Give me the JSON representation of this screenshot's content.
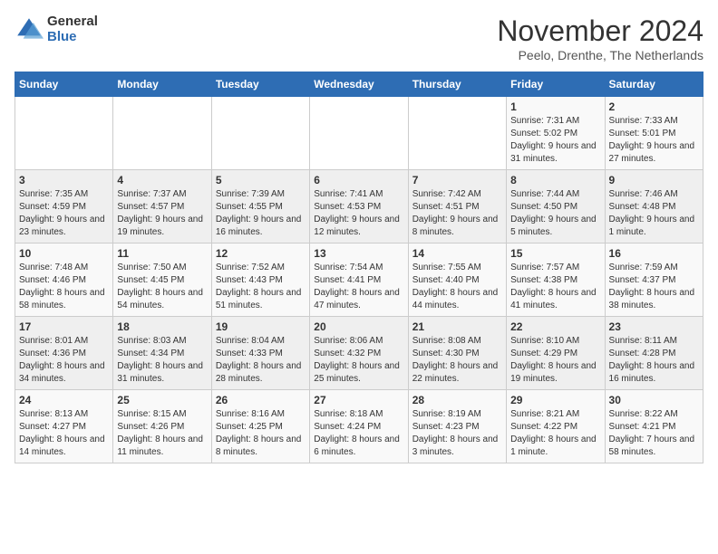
{
  "logo": {
    "general": "General",
    "blue": "Blue"
  },
  "header": {
    "month": "November 2024",
    "location": "Peelo, Drenthe, The Netherlands"
  },
  "weekdays": [
    "Sunday",
    "Monday",
    "Tuesday",
    "Wednesday",
    "Thursday",
    "Friday",
    "Saturday"
  ],
  "weeks": [
    [
      {
        "day": "",
        "info": ""
      },
      {
        "day": "",
        "info": ""
      },
      {
        "day": "",
        "info": ""
      },
      {
        "day": "",
        "info": ""
      },
      {
        "day": "",
        "info": ""
      },
      {
        "day": "1",
        "info": "Sunrise: 7:31 AM\nSunset: 5:02 PM\nDaylight: 9 hours and 31 minutes."
      },
      {
        "day": "2",
        "info": "Sunrise: 7:33 AM\nSunset: 5:01 PM\nDaylight: 9 hours and 27 minutes."
      }
    ],
    [
      {
        "day": "3",
        "info": "Sunrise: 7:35 AM\nSunset: 4:59 PM\nDaylight: 9 hours and 23 minutes."
      },
      {
        "day": "4",
        "info": "Sunrise: 7:37 AM\nSunset: 4:57 PM\nDaylight: 9 hours and 19 minutes."
      },
      {
        "day": "5",
        "info": "Sunrise: 7:39 AM\nSunset: 4:55 PM\nDaylight: 9 hours and 16 minutes."
      },
      {
        "day": "6",
        "info": "Sunrise: 7:41 AM\nSunset: 4:53 PM\nDaylight: 9 hours and 12 minutes."
      },
      {
        "day": "7",
        "info": "Sunrise: 7:42 AM\nSunset: 4:51 PM\nDaylight: 9 hours and 8 minutes."
      },
      {
        "day": "8",
        "info": "Sunrise: 7:44 AM\nSunset: 4:50 PM\nDaylight: 9 hours and 5 minutes."
      },
      {
        "day": "9",
        "info": "Sunrise: 7:46 AM\nSunset: 4:48 PM\nDaylight: 9 hours and 1 minute."
      }
    ],
    [
      {
        "day": "10",
        "info": "Sunrise: 7:48 AM\nSunset: 4:46 PM\nDaylight: 8 hours and 58 minutes."
      },
      {
        "day": "11",
        "info": "Sunrise: 7:50 AM\nSunset: 4:45 PM\nDaylight: 8 hours and 54 minutes."
      },
      {
        "day": "12",
        "info": "Sunrise: 7:52 AM\nSunset: 4:43 PM\nDaylight: 8 hours and 51 minutes."
      },
      {
        "day": "13",
        "info": "Sunrise: 7:54 AM\nSunset: 4:41 PM\nDaylight: 8 hours and 47 minutes."
      },
      {
        "day": "14",
        "info": "Sunrise: 7:55 AM\nSunset: 4:40 PM\nDaylight: 8 hours and 44 minutes."
      },
      {
        "day": "15",
        "info": "Sunrise: 7:57 AM\nSunset: 4:38 PM\nDaylight: 8 hours and 41 minutes."
      },
      {
        "day": "16",
        "info": "Sunrise: 7:59 AM\nSunset: 4:37 PM\nDaylight: 8 hours and 38 minutes."
      }
    ],
    [
      {
        "day": "17",
        "info": "Sunrise: 8:01 AM\nSunset: 4:36 PM\nDaylight: 8 hours and 34 minutes."
      },
      {
        "day": "18",
        "info": "Sunrise: 8:03 AM\nSunset: 4:34 PM\nDaylight: 8 hours and 31 minutes."
      },
      {
        "day": "19",
        "info": "Sunrise: 8:04 AM\nSunset: 4:33 PM\nDaylight: 8 hours and 28 minutes."
      },
      {
        "day": "20",
        "info": "Sunrise: 8:06 AM\nSunset: 4:32 PM\nDaylight: 8 hours and 25 minutes."
      },
      {
        "day": "21",
        "info": "Sunrise: 8:08 AM\nSunset: 4:30 PM\nDaylight: 8 hours and 22 minutes."
      },
      {
        "day": "22",
        "info": "Sunrise: 8:10 AM\nSunset: 4:29 PM\nDaylight: 8 hours and 19 minutes."
      },
      {
        "day": "23",
        "info": "Sunrise: 8:11 AM\nSunset: 4:28 PM\nDaylight: 8 hours and 16 minutes."
      }
    ],
    [
      {
        "day": "24",
        "info": "Sunrise: 8:13 AM\nSunset: 4:27 PM\nDaylight: 8 hours and 14 minutes."
      },
      {
        "day": "25",
        "info": "Sunrise: 8:15 AM\nSunset: 4:26 PM\nDaylight: 8 hours and 11 minutes."
      },
      {
        "day": "26",
        "info": "Sunrise: 8:16 AM\nSunset: 4:25 PM\nDaylight: 8 hours and 8 minutes."
      },
      {
        "day": "27",
        "info": "Sunrise: 8:18 AM\nSunset: 4:24 PM\nDaylight: 8 hours and 6 minutes."
      },
      {
        "day": "28",
        "info": "Sunrise: 8:19 AM\nSunset: 4:23 PM\nDaylight: 8 hours and 3 minutes."
      },
      {
        "day": "29",
        "info": "Sunrise: 8:21 AM\nSunset: 4:22 PM\nDaylight: 8 hours and 1 minute."
      },
      {
        "day": "30",
        "info": "Sunrise: 8:22 AM\nSunset: 4:21 PM\nDaylight: 7 hours and 58 minutes."
      }
    ]
  ]
}
